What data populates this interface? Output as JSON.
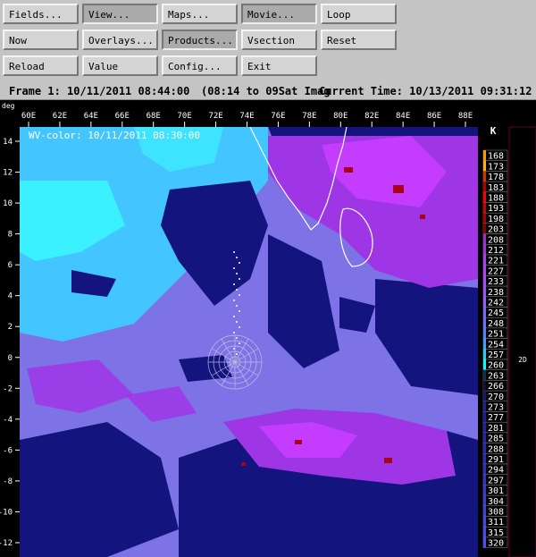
{
  "toolbar": {
    "buttons": [
      {
        "label": "Fields...",
        "state": "raised"
      },
      {
        "label": "View...",
        "state": "pressed"
      },
      {
        "label": "Maps...",
        "state": "raised"
      },
      {
        "label": "Movie...",
        "state": "pressed"
      },
      {
        "label": "Loop",
        "state": "raised"
      },
      {
        "label": "Now",
        "state": "raised"
      },
      {
        "label": "Overlays...",
        "state": "raised"
      },
      {
        "label": "Products...",
        "state": "pressed"
      },
      {
        "label": "Vsection",
        "state": "raised"
      },
      {
        "label": "Reset",
        "state": "raised"
      },
      {
        "label": "Reload",
        "state": "raised"
      },
      {
        "label": "Value",
        "state": "raised"
      },
      {
        "label": "Config...",
        "state": "raised"
      },
      {
        "label": "Exit",
        "state": "raised"
      }
    ]
  },
  "status": {
    "frame": "Frame 1: 10/11/2011 08:44:00",
    "range": "(08:14 to 09Sat Imag",
    "current": "Current Time: 10/13/2011 09:31:12"
  },
  "map": {
    "y_unit": "deg",
    "field_label": "WV-color: 10/11/2011 08:30:00",
    "x_ticks": [
      "60E",
      "62E",
      "64E",
      "66E",
      "68E",
      "70E",
      "72E",
      "74E",
      "76E",
      "78E",
      "80E",
      "82E",
      "84E",
      "86E",
      "88E"
    ],
    "y_ticks": [
      "14",
      "12",
      "10",
      "8",
      "6",
      "4",
      "2",
      "0",
      "-2",
      "-4",
      "-6",
      "-8",
      "-10",
      "-12"
    ],
    "lon_range": [
      60,
      88
    ],
    "lat_range": [
      -12,
      14
    ]
  },
  "colorscale": {
    "unit": "K",
    "mode_label": "2D",
    "entries": [
      {
        "label": "168",
        "color": "#ff9900"
      },
      {
        "label": "173",
        "color": "#ffb000"
      },
      {
        "label": "178",
        "color": "#cc3300"
      },
      {
        "label": "183",
        "color": "#b00000"
      },
      {
        "label": "188",
        "color": "#ff0000"
      },
      {
        "label": "193",
        "color": "#cc0000"
      },
      {
        "label": "198",
        "color": "#aa0000"
      },
      {
        "label": "203",
        "color": "#880000"
      },
      {
        "label": "208",
        "color": "#9a2ed0"
      },
      {
        "label": "212",
        "color": "#a030e0"
      },
      {
        "label": "221",
        "color": "#a840f0"
      },
      {
        "label": "227",
        "color": "#b040ff"
      },
      {
        "label": "233",
        "color": "#a848ff"
      },
      {
        "label": "238",
        "color": "#9c50ff"
      },
      {
        "label": "242",
        "color": "#9060ff"
      },
      {
        "label": "245",
        "color": "#7a66ff"
      },
      {
        "label": "248",
        "color": "#6a70ff"
      },
      {
        "label": "251",
        "color": "#5a80ff"
      },
      {
        "label": "254",
        "color": "#40a0ff"
      },
      {
        "label": "257",
        "color": "#20d0ff"
      },
      {
        "label": "260",
        "color": "#00ffff"
      },
      {
        "label": "263",
        "color": "#10304a"
      },
      {
        "label": "266",
        "color": "#10103a"
      },
      {
        "label": "270",
        "color": "#1a1a6a"
      },
      {
        "label": "273",
        "color": "#202088"
      },
      {
        "label": "277",
        "color": "#1c1c9a"
      },
      {
        "label": "281",
        "color": "#2020a0"
      },
      {
        "label": "285",
        "color": "#2424a8"
      },
      {
        "label": "288",
        "color": "#2828b0"
      },
      {
        "label": "291",
        "color": "#2c2cb8"
      },
      {
        "label": "294",
        "color": "#3030c0"
      },
      {
        "label": "297",
        "color": "#3434c8"
      },
      {
        "label": "301",
        "color": "#3838d0"
      },
      {
        "label": "304",
        "color": "#3c3cd8"
      },
      {
        "label": "308",
        "color": "#4040e0"
      },
      {
        "label": "311",
        "color": "#4444e8"
      },
      {
        "label": "315",
        "color": "#4848f0"
      },
      {
        "label": "320",
        "color": "#4c4cf8"
      }
    ]
  },
  "colors": {
    "background_purple": "#7d72e6",
    "cyan_region": "#43c6ff",
    "light_cyan": "#3bf0ff",
    "dark_blue": "#14147f",
    "deep_purple": "#9f36e6",
    "magenta": "#c33cff",
    "dark_red": "#aa0018",
    "coastline": "#ffffff"
  }
}
